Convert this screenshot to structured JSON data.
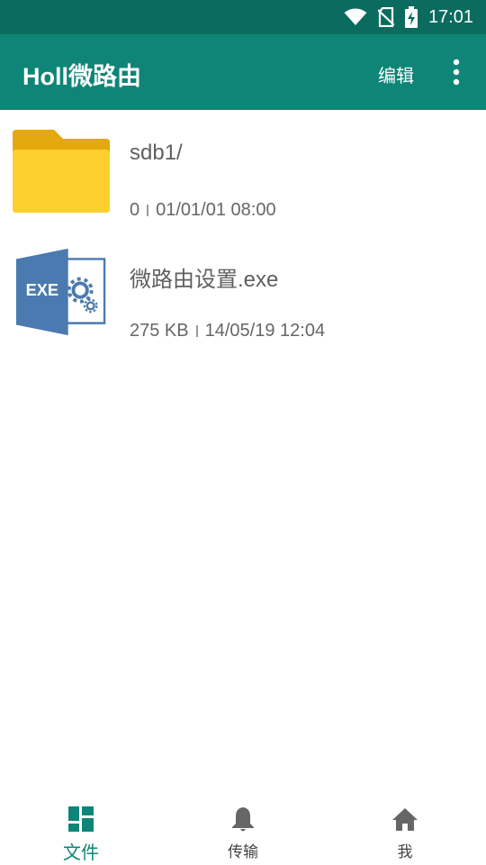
{
  "status_bar": {
    "time": "17:01",
    "icons": [
      "wifi-icon",
      "no-sim-icon",
      "battery-charging-icon"
    ]
  },
  "app_bar": {
    "title": "Holl微路由",
    "edit_label": "编辑",
    "more_icon": "more-vert-icon"
  },
  "files": [
    {
      "name": "sdb1/",
      "size": "0",
      "date": "01/01/01 08:00",
      "icon": "folder-icon"
    },
    {
      "name": "微路由设置.exe",
      "size": "275 KB",
      "date": "14/05/19 12:04",
      "icon": "exe-file-icon"
    }
  ],
  "bottom_nav": [
    {
      "label": "文件",
      "icon": "dashboard-icon",
      "active": true
    },
    {
      "label": "传输",
      "icon": "bell-icon",
      "active": false
    },
    {
      "label": "我",
      "icon": "home-icon",
      "active": false
    }
  ],
  "colors": {
    "status_bar": "#0a6b5e",
    "app_bar": "#0e8576",
    "accent": "#0e8576",
    "folder": "#fcd02f",
    "exe_blue": "#4a7ab0"
  }
}
